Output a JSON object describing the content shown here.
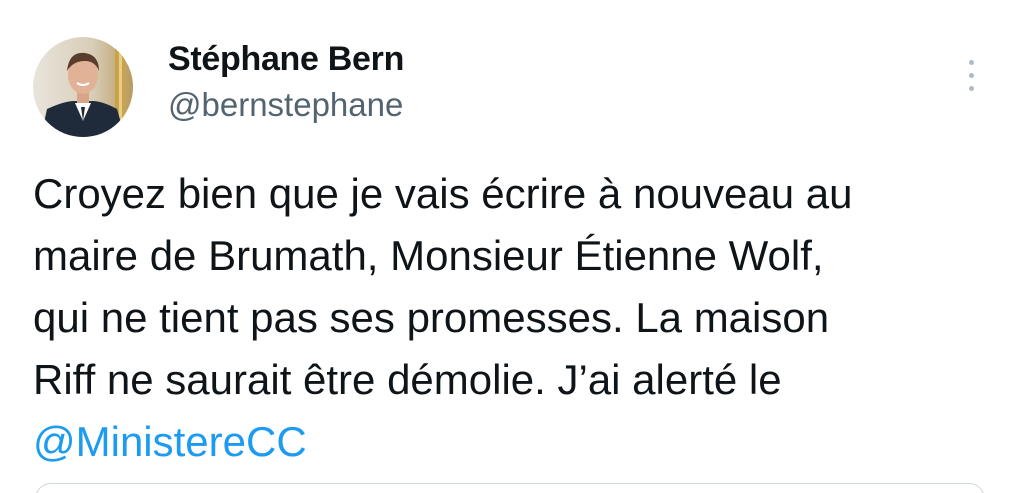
{
  "author": {
    "display_name": "Stéphane Bern",
    "handle": "@bernstephane",
    "avatar_icon": "profile-photo"
  },
  "more_icon": "more-vertical-icon",
  "tweet": {
    "lines": [
      "Croyez bien que je vais écrire à nouveau au",
      "maire de Brumath, Monsieur Étienne Wolf,",
      "qui ne tient pas ses promesses. La maison",
      "Riff ne saurait être démolie. J’ai alerté le"
    ],
    "mention": "@MinistereCC"
  },
  "colors": {
    "text": "#0f1419",
    "secondary": "#536471",
    "link": "#1d9bf0",
    "border": "#cfd9de"
  }
}
